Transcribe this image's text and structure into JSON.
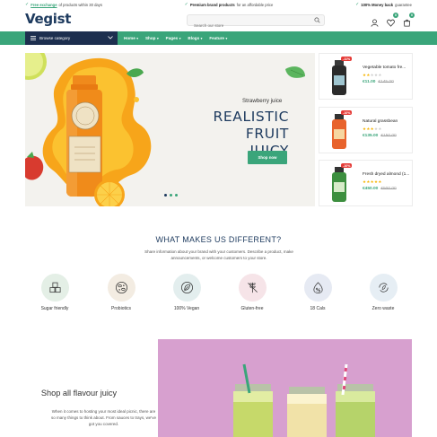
{
  "topbar": {
    "left_highlight": "Free exchange",
    "left_text": "of products within 30 days",
    "center_strong": "Premium brand products",
    "center_text": "for an affordable price",
    "right_strong": "100% Money back",
    "right_text": "guarantee"
  },
  "header": {
    "logo": "Vegist",
    "search_placeholder": "Search our store",
    "wishlist_count": "0",
    "cart_count": "0"
  },
  "nav": {
    "browse_label": "Browse category",
    "items": [
      {
        "label": "Home",
        "caret": "▾"
      },
      {
        "label": "Shop",
        "caret": "▾"
      },
      {
        "label": "Pages",
        "caret": "▾"
      },
      {
        "label": "Blogs",
        "caret": "▾"
      },
      {
        "label": "Feature",
        "caret": "▾"
      }
    ]
  },
  "hero": {
    "subtitle": "Strawberry juice",
    "title_line1": "REALISTIC",
    "title_line2": "FRUIT JUICY",
    "button": "Shop now"
  },
  "side_products": [
    {
      "name": "Vegetable tomato fre...",
      "price": "€11.00",
      "old_price": "€145.00",
      "sale": "-11%",
      "rating": 2,
      "color": "#2b2b2b"
    },
    {
      "name": "Natural grassbean",
      "price": "€135.00",
      "old_price": "€150.00",
      "sale": "-10%",
      "rating": 3,
      "color": "#e8632c"
    },
    {
      "name": "Fresh dryed almond (1...",
      "price": "€450.00",
      "old_price": "€500.00",
      "sale": "-10%",
      "rating": 5,
      "color": "#3d8f3f"
    }
  ],
  "features": {
    "title": "WHAT MAKES US DIFFERENT?",
    "description": "Share information about your brand with your customers. Describe a product, make announcements, or welcome customers to your store.",
    "items": [
      {
        "label": "Sugar friendly",
        "icon": "sugar-cubes-icon",
        "bg": "#e4efe6"
      },
      {
        "label": "Probiotics",
        "icon": "probiotics-icon",
        "bg": "#f3ece2"
      },
      {
        "label": "100% Vegan",
        "icon": "vegan-leaf-icon",
        "bg": "#e3eeee"
      },
      {
        "label": "Gluten-free",
        "icon": "gluten-free-icon",
        "bg": "#f6e4e8"
      },
      {
        "label": "18 Cals",
        "icon": "calories-icon",
        "bg": "#e6eaf3"
      },
      {
        "label": "Zero waste",
        "icon": "zero-waste-icon",
        "bg": "#e6eef4"
      }
    ]
  },
  "promo": {
    "title": "Shop all flavour juicy",
    "description": "When it comes to hosting your most ideal picnic, there are so many things to think about. From sauces to trays, we've got you covered."
  }
}
